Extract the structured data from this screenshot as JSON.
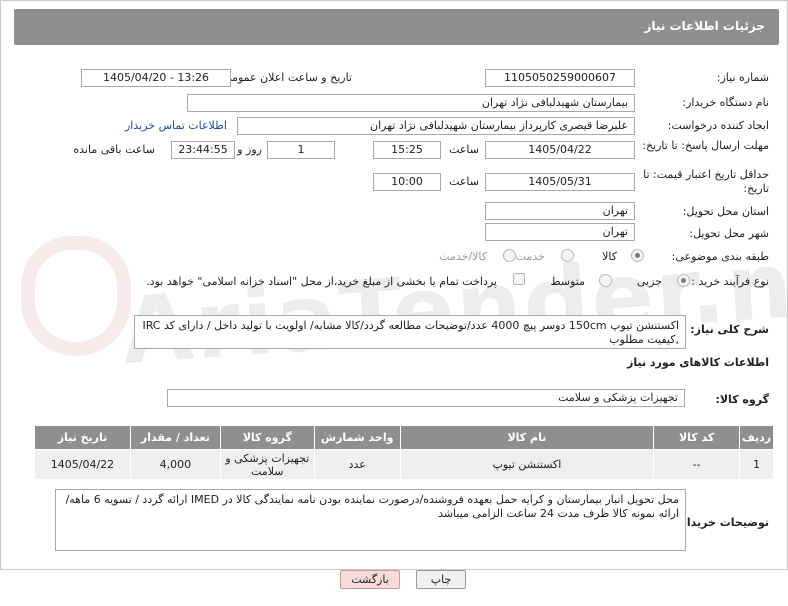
{
  "header": {
    "title": "جزئیات اطلاعات نیاز"
  },
  "watermark": "AriaTender.net",
  "fields": {
    "need_number": {
      "label": "شماره نیاز:",
      "value": "1105050259000607"
    },
    "announce_date": {
      "label": "تاریخ و ساعت اعلان عمومی:",
      "value": "1405/04/20 - 13:26"
    },
    "buyer_org": {
      "label": "نام دستگاه خریدار:",
      "value": "بیمارستان شهیدلبافی نژاد تهران"
    },
    "requester": {
      "label": "ایجاد کننده درخواست:",
      "value": "علیرضا قیصری کارپرداز بیمارستان شهیدلبافی نژاد تهران",
      "contact_link": "اطلاعات تماس خریدار"
    },
    "reply_deadline": {
      "label": "مهلت ارسال پاسخ: تا تاریخ:",
      "date": "1405/04/22",
      "time_label": "ساعت",
      "time": "15:25",
      "days": "1",
      "days_label": "روز و",
      "remaining": "23:44:55",
      "remaining_label": "ساعت باقی مانده"
    },
    "price_validity": {
      "label": "حداقل تاریخ اعتبار قیمت: تا تاریخ:",
      "date": "1405/05/31",
      "time_label": "ساعت",
      "time": "10:00"
    },
    "delivery_province": {
      "label": "استان محل تحویل:",
      "value": "تهران"
    },
    "delivery_city": {
      "label": "شهر محل تحویل:",
      "value": "تهران"
    },
    "category": {
      "label": "طبقه بندی موضوعی:",
      "options": [
        "کالا",
        "خدمت",
        "کالا/خدمت"
      ],
      "selected": "کالا"
    },
    "process_type": {
      "label": "نوع فرآیند خرید :",
      "options": [
        "جزیی",
        "متوسط"
      ],
      "selected": "جزیی",
      "payment_note": "پرداخت تمام یا بخشی از مبلغ خرید،از محل \"اسناد خزانه اسلامی\" خواهد بود."
    },
    "description": {
      "label": "شرح کلی نیاز:",
      "value": "اکستنشن تیوپ 150cm دوسر پیچ   4000 عدد/توضیحات مطالعه گردد/کالا مشابه/ اولویت با تولید داخل / دارای کد IRC ,کیفیت مطلوب"
    }
  },
  "goods_section": {
    "title": "اطلاعات کالاهای مورد نیاز",
    "group_label": "گروه کالا:",
    "group_value": "تجهیزات پزشکی و سلامت"
  },
  "table": {
    "headers": [
      "ردیف",
      "کد کالا",
      "نام کالا",
      "واحد شمارش",
      "گروه کالا",
      "تعداد / مقدار",
      "تاریخ نیاز"
    ],
    "rows": [
      [
        "1",
        "--",
        "اکستنشن تیوپ",
        "عدد",
        "تجهیزات پزشکی و سلامت",
        "4,000",
        "1405/04/22"
      ]
    ]
  },
  "buyer_notes": {
    "label": "توضیحات خریدار:",
    "value": "محل تحویل انبار بیمارستان و کرایه حمل بعهده فروشنده/درصورت نماینده بودن نامه نمایندگی کالا در  IMED ارائه گردد / تسویه 6 ماهه/ ارائه نمونه کالا ظرف مدت 24 ساعت الزامی میباشد"
  },
  "buttons": {
    "print": "چاپ",
    "back": "بازگشت"
  }
}
